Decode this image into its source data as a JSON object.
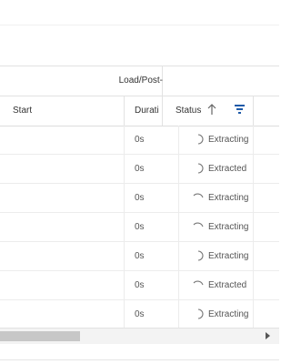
{
  "grid": {
    "group_header": "Load/Post-",
    "columns": {
      "start": "Start",
      "duration": "Durati",
      "status": "Status"
    },
    "sort_icon": "arrow-up-icon",
    "filter_icon": "filter-icon",
    "rows": [
      {
        "duration": "0s",
        "status": "Extracting",
        "spinner": "arc-right-icon"
      },
      {
        "duration": "0s",
        "status": "Extracted",
        "spinner": "arc-right-icon"
      },
      {
        "duration": "0s",
        "status": "Extracting",
        "spinner": "arc-top-icon"
      },
      {
        "duration": "0s",
        "status": "Extracting",
        "spinner": "arc-top-icon"
      },
      {
        "duration": "0s",
        "status": "Extracting",
        "spinner": "arc-right-icon"
      },
      {
        "duration": "0s",
        "status": "Extracted",
        "spinner": "arc-top-icon"
      },
      {
        "duration": "0s",
        "status": "Extracting",
        "spinner": "arc-right-icon"
      }
    ]
  },
  "colors": {
    "filter": "#1e5aa8",
    "text": "#333333",
    "spinner": "#777777"
  }
}
